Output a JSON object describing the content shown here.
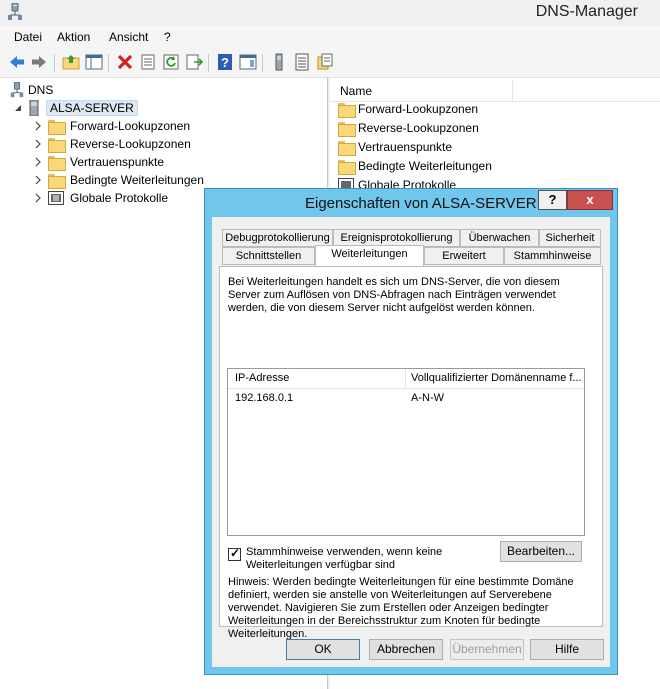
{
  "window": {
    "title": "DNS-Manager"
  },
  "menu": [
    "Datei",
    "Aktion",
    "Ansicht",
    "?"
  ],
  "tree": {
    "root": "DNS",
    "server": "ALSA-SERVER",
    "children": [
      "Forward-Lookupzonen",
      "Reverse-Lookupzonen",
      "Vertrauenspunkte",
      "Bedingte Weiterleitungen",
      "Globale Protokolle"
    ]
  },
  "list": {
    "column_name": "Name",
    "items": [
      "Forward-Lookupzonen",
      "Reverse-Lookupzonen",
      "Vertrauenspunkte",
      "Bedingte Weiterleitungen",
      "Globale Protokolle"
    ]
  },
  "dialog": {
    "title": "Eigenschaften von ALSA-SERVER",
    "help_label": "?",
    "close_label": "x",
    "tabs_row1": [
      "Debugprotokollierung",
      "Ereignisprotokollierung",
      "Überwachen",
      "Sicherheit"
    ],
    "tabs_row2": [
      "Schnittstellen",
      "Weiterleitungen",
      "Erweitert",
      "Stammhinweise"
    ],
    "active_tab": "Weiterleitungen",
    "description": "Bei Weiterleitungen handelt es sich um DNS-Server, die von diesem Server zum Auflösen von DNS-Abfragen nach Einträgen verwendet werden, die von diesem Server nicht aufgelöst werden können.",
    "table": {
      "col_ip": "IP-Adresse",
      "col_fqdn": "Vollqualifizierter Domänenname f...",
      "rows": [
        {
          "ip": "192.168.0.1",
          "fqdn": "A-N-W"
        }
      ]
    },
    "checkbox_label": "Stammhinweise verwenden, wenn keine Weiterleitungen verfügbar sind",
    "checkbox_checked": true,
    "edit_button": "Bearbeiten...",
    "note": "Hinweis: Werden bedingte Weiterleitungen für eine bestimmte Domäne definiert, werden sie anstelle von Weiterleitungen auf Serverebene verwendet. Navigieren Sie zum Erstellen oder Anzeigen bedingter Weiterleitungen in der Bereichsstruktur zum Knoten für bedingte Weiterleitungen.",
    "buttons": {
      "ok": "OK",
      "cancel": "Abbrechen",
      "apply": "Übernehmen",
      "help": "Hilfe"
    }
  }
}
